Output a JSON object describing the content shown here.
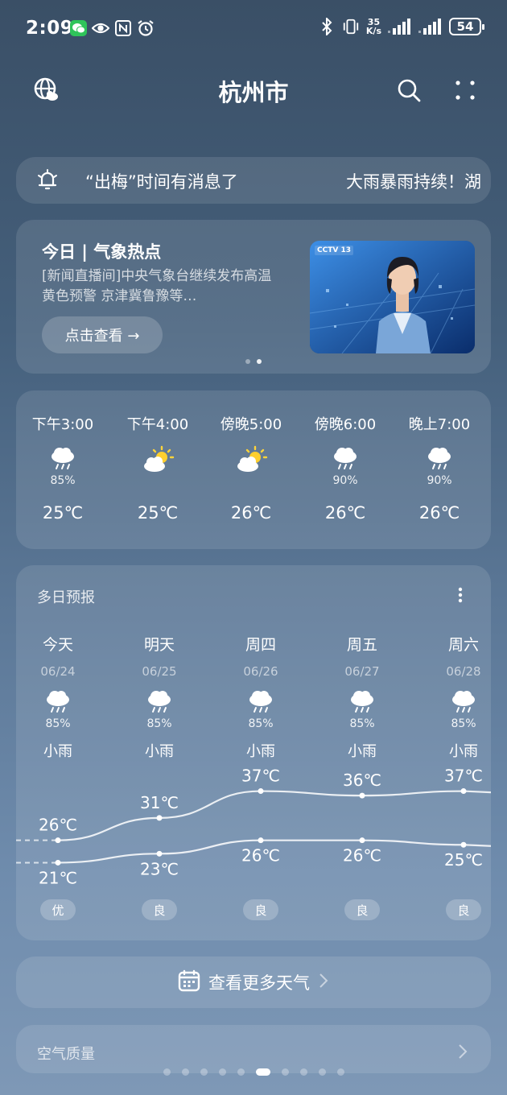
{
  "status_bar": {
    "time": "2:09",
    "net_speed_value": "35",
    "net_speed_unit": "K/s",
    "battery": "54"
  },
  "header": {
    "city": "杭州市"
  },
  "ticker": {
    "text": "“出梅”时间有消息了",
    "text2": "大雨暴雨持续！湖"
  },
  "news": {
    "title": "今日 | 气象热点",
    "description": "[新闻直播间]中央气象台继续发布高温黄色预警 京津冀鲁豫等…",
    "button": "点击查看 →",
    "thumb_logo": "CCTV 13"
  },
  "hourly": [
    {
      "time": "下午3:00",
      "icon": "rain-cloud-icon",
      "precip": "85%",
      "temp": "25℃"
    },
    {
      "time": "下午4:00",
      "icon": "partly-sunny-icon",
      "precip": "",
      "temp": "25℃"
    },
    {
      "time": "傍晚5:00",
      "icon": "partly-sunny-icon",
      "precip": "",
      "temp": "26℃"
    },
    {
      "time": "傍晚6:00",
      "icon": "rain-cloud-icon",
      "precip": "90%",
      "temp": "26℃"
    },
    {
      "time": "晚上7:00",
      "icon": "rain-cloud-icon",
      "precip": "90%",
      "temp": "26℃"
    }
  ],
  "daily": {
    "title": "多日预报",
    "days": [
      {
        "name": "今天",
        "date": "06/24",
        "precip": "85%",
        "cond": "小雨",
        "high": "26℃",
        "low": "21℃",
        "aqi": "优",
        "high_v": 26,
        "low_v": 21
      },
      {
        "name": "明天",
        "date": "06/25",
        "precip": "85%",
        "cond": "小雨",
        "high": "31℃",
        "low": "23℃",
        "aqi": "良",
        "high_v": 31,
        "low_v": 23
      },
      {
        "name": "周四",
        "date": "06/26",
        "precip": "85%",
        "cond": "小雨",
        "high": "37℃",
        "low": "26℃",
        "aqi": "良",
        "high_v": 37,
        "low_v": 26
      },
      {
        "name": "周五",
        "date": "06/27",
        "precip": "85%",
        "cond": "小雨",
        "high": "36℃",
        "low": "26℃",
        "aqi": "良",
        "high_v": 36,
        "low_v": 26
      },
      {
        "name": "周六",
        "date": "06/28",
        "precip": "85%",
        "cond": "小雨",
        "high": "37℃",
        "low": "25℃",
        "aqi": "良",
        "high_v": 37,
        "low_v": 25
      }
    ]
  },
  "more_weather": {
    "label": "查看更多天气"
  },
  "air_quality": {
    "label": "空气质量"
  },
  "page_indicator": {
    "count": 10,
    "active": 5
  }
}
